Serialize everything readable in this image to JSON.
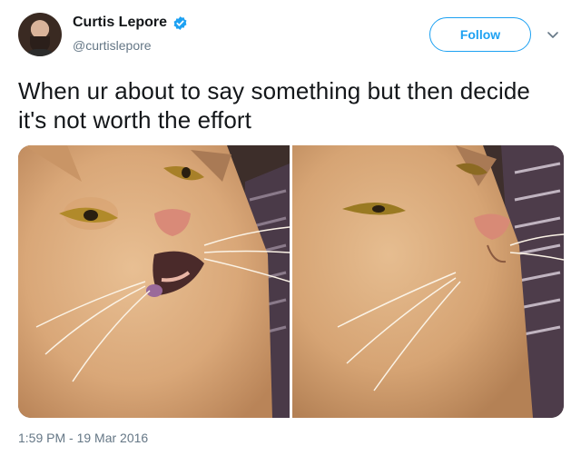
{
  "author": {
    "display_name": "Curtis Lepore",
    "handle": "@curtislepore",
    "verified": true,
    "avatar_icon": "avatar-photo"
  },
  "actions": {
    "follow_label": "Follow",
    "more_icon": "chevron-down-icon"
  },
  "tweet": {
    "text": "When ur about to say something but then decide it's not worth the effort",
    "timestamp": "1:59 PM - 19 Mar 2016"
  },
  "media": [
    {
      "name": "cat-photo-mouth-open"
    },
    {
      "name": "cat-photo-mouth-closed"
    }
  ],
  "colors": {
    "accent": "#1da1f2",
    "text": "#14171a",
    "secondary": "#657786"
  }
}
